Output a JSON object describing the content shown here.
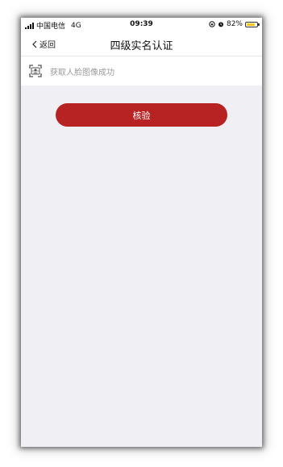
{
  "status_bar": {
    "carrier": "中国电信",
    "network": "4G",
    "time": "09:39",
    "battery_percent": "82%",
    "battery_level": 0.82,
    "battery_color": "#f5c518"
  },
  "nav": {
    "back_label": "返回",
    "title": "四级实名认证"
  },
  "face_row": {
    "icon": "face-scan-icon",
    "text": "获取人脸图像成功"
  },
  "verify_button": {
    "label": "核验",
    "color": "#b62322"
  }
}
